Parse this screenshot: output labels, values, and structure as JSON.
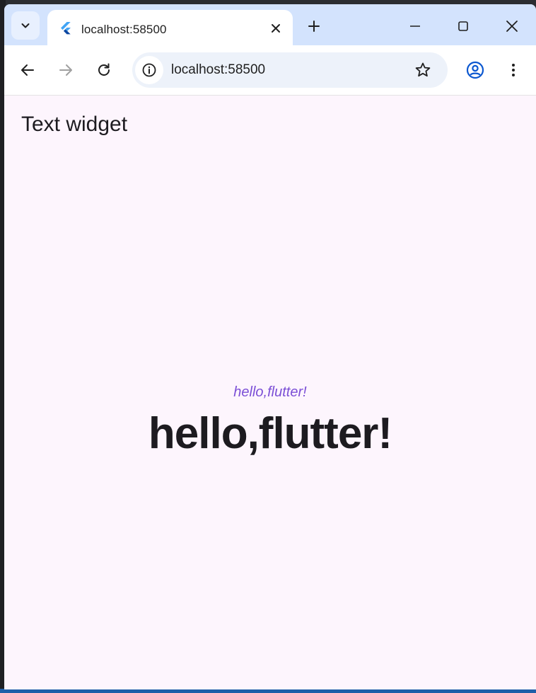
{
  "browser": {
    "tab": {
      "title": "localhost:58500",
      "favicon": "flutter-logo-icon"
    },
    "address_bar": {
      "url": "localhost:58500"
    },
    "icons": {
      "tab_search": "chevron-down-icon",
      "tab_close": "close-icon",
      "new_tab": "plus-icon",
      "minimize": "minimize-icon",
      "maximize": "maximize-icon",
      "window_close": "close-icon",
      "back": "arrow-back-icon",
      "forward": "arrow-forward-icon",
      "reload": "reload-icon",
      "site_info": "info-icon",
      "bookmark": "star-icon",
      "profile": "account-icon",
      "menu": "more-vert-icon"
    },
    "colors": {
      "tabstrip": "#d3e3fd",
      "profile_accent": "#0b57d0"
    }
  },
  "app": {
    "title": "Text widget",
    "small_text": "hello,flutter!",
    "big_text": "hello,flutter!",
    "colors": {
      "background": "#fdf5fd",
      "small_text": "#7b4fd6",
      "big_text": "#1d1b20"
    }
  }
}
